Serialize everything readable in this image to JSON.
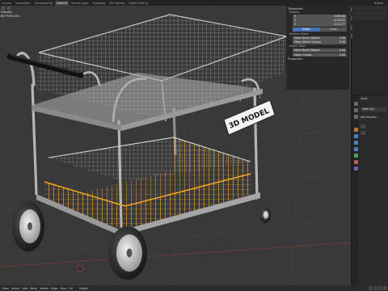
{
  "tabs": [
    {
      "label": "Layout"
    },
    {
      "label": "Animation"
    },
    {
      "label": "Compositing"
    },
    {
      "label": "Default"
    },
    {
      "label": "Game Logic"
    },
    {
      "label": "Scripting"
    },
    {
      "label": "UV Editing"
    },
    {
      "label": "Video Editing"
    }
  ],
  "scene_label": "Scene",
  "viewport_info": {
    "mode": "Graphic",
    "object": "BOTTOM.001"
  },
  "sign_text": "3D MODEL",
  "npanel": {
    "header": "Transform",
    "median_label": "Median:",
    "fields": [
      {
        "axis": "X",
        "value": "0.65188"
      },
      {
        "axis": "Y",
        "value": "-0.23432"
      },
      {
        "axis": "Z",
        "value": "0.21777"
      }
    ],
    "toggle": {
      "on": "Global",
      "off": "Local"
    },
    "vertices_header": "Vertices Data:",
    "vertex_fields": [
      {
        "label": "Mean Bevel Weight",
        "value": "0.00"
      },
      {
        "label": "Mean Vertex Crease",
        "value": "0.00"
      }
    ],
    "edges_header": "Edges Data:",
    "edge_fields": [
      {
        "label": "Mean Bevel Weight",
        "value": "0.00"
      },
      {
        "label": "Mean Crease",
        "value": "0.00"
      }
    ],
    "properties_header": "Properties",
    "side_tabs": [
      "Item",
      "Tool",
      "View",
      "Edit"
    ]
  },
  "props_panel": {
    "view_label": "View",
    "object_name": "WIRE.001",
    "add_modifier": "Add Modifier"
  },
  "bottom_menu": [
    {
      "label": "View"
    },
    {
      "label": "Select"
    },
    {
      "label": "Add"
    },
    {
      "label": "Mesh"
    },
    {
      "label": "Vertex"
    },
    {
      "label": "Edge"
    },
    {
      "label": "Face"
    },
    {
      "label": "UV"
    }
  ],
  "transform_orientation": "Global",
  "colors": {
    "accent": "#4772b3",
    "selection": "#f5a623",
    "viewport_bg": "#393939",
    "panel_bg": "#262626"
  }
}
